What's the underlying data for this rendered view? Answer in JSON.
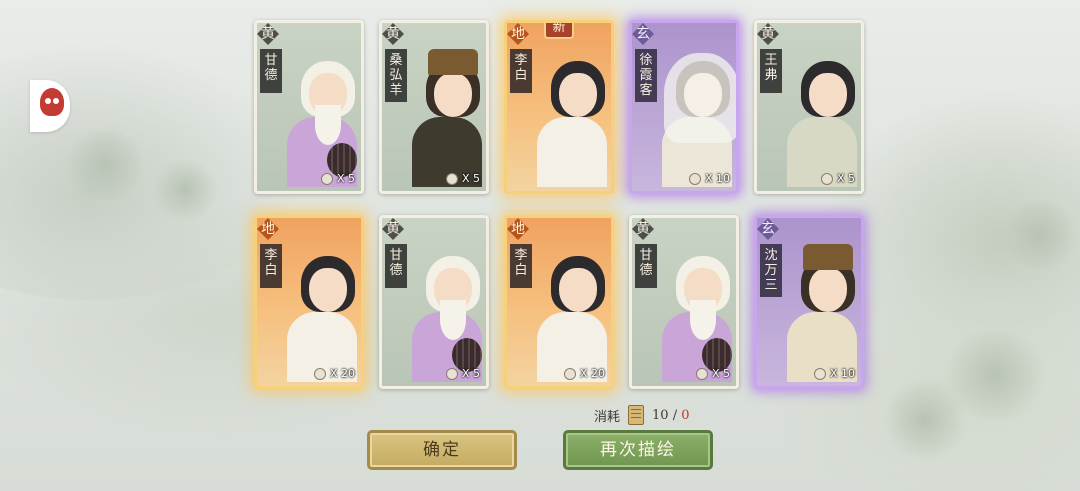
{
  "cards": [
    {
      "tier": "黄",
      "tier_class": "huang",
      "name": "甘德",
      "count": "X 5",
      "is_new": false,
      "hair": "#f3f0e6",
      "robe": "#c9a5d8"
    },
    {
      "tier": "黄",
      "tier_class": "huang",
      "name": "桑弘羊",
      "count": "X 5",
      "is_new": false,
      "hair": "#3a3026",
      "robe": "#3f3a2e"
    },
    {
      "tier": "地",
      "tier_class": "di",
      "name": "李白",
      "count": "",
      "is_new": true,
      "hair": "#2d2a2e",
      "robe": "#f4f0e6"
    },
    {
      "tier": "玄",
      "tier_class": "xuan",
      "name": "徐霞客",
      "count": "X 10",
      "is_new": false,
      "hair": "#3a3026",
      "robe": "#ece6d8"
    },
    {
      "tier": "黄",
      "tier_class": "huang",
      "name": "王弗",
      "count": "X 5",
      "is_new": false,
      "hair": "#2d2a2e",
      "robe": "#d7d9c4"
    },
    {
      "tier": "地",
      "tier_class": "di",
      "name": "李白",
      "count": "X 20",
      "is_new": false,
      "hair": "#2d2a2e",
      "robe": "#f4f0e6"
    },
    {
      "tier": "黄",
      "tier_class": "huang",
      "name": "甘德",
      "count": "X 5",
      "is_new": false,
      "hair": "#f3f0e6",
      "robe": "#c9a5d8"
    },
    {
      "tier": "地",
      "tier_class": "di",
      "name": "李白",
      "count": "X 20",
      "is_new": false,
      "hair": "#2d2a2e",
      "robe": "#f4f0e6"
    },
    {
      "tier": "黄",
      "tier_class": "huang",
      "name": "甘德",
      "count": "X 5",
      "is_new": false,
      "hair": "#f3f0e6",
      "robe": "#c9a5d8"
    },
    {
      "tier": "玄",
      "tier_class": "xuan",
      "name": "沈万三",
      "count": "X 10",
      "is_new": false,
      "hair": "#3a3026",
      "robe": "#e9dfc7"
    }
  ],
  "new_tag": "新",
  "cost": {
    "label": "消耗",
    "have": "10",
    "separator": "/",
    "remaining": "0"
  },
  "buttons": {
    "confirm": "确定",
    "redraw": "再次描绘"
  }
}
